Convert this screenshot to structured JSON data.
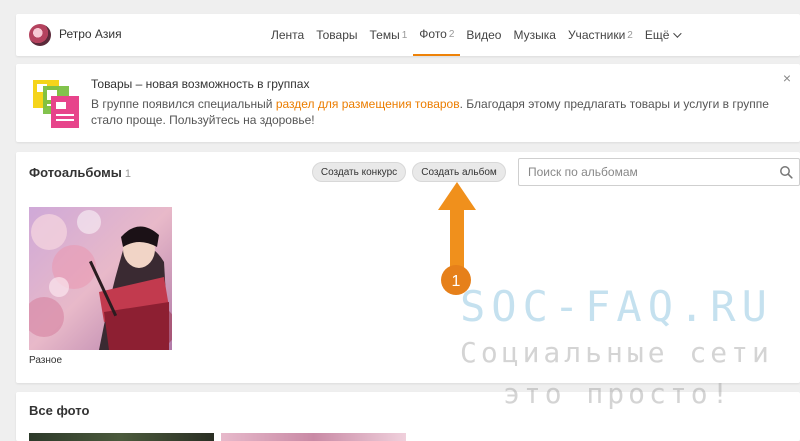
{
  "group": {
    "name": "Ретро Азия"
  },
  "nav": [
    {
      "label": "Лента",
      "count": ""
    },
    {
      "label": "Товары",
      "count": ""
    },
    {
      "label": "Темы",
      "count": "1"
    },
    {
      "label": "Фото",
      "count": "2"
    },
    {
      "label": "Видео",
      "count": ""
    },
    {
      "label": "Музыка",
      "count": ""
    },
    {
      "label": "Участники",
      "count": "2"
    },
    {
      "label": "Ещё",
      "count": ""
    }
  ],
  "active_nav": "Фото",
  "promo": {
    "title": "Товары – новая возможность в группах",
    "text_before": "В группе появился специальный ",
    "link": "раздел для размещения товаров",
    "text_after": ". Благодаря этому предлагать товары и услуги в группе стало проще. Пользуйтесь на здоровье!",
    "close": "×"
  },
  "albums": {
    "title": "Фотоальбомы",
    "count": "1",
    "btn_contest": "Создать конкурс",
    "btn_album": "Создать альбом",
    "search_placeholder": "Поиск по альбомам",
    "items": [
      {
        "label": "Разное"
      }
    ]
  },
  "all_photos": {
    "title": "Все фото"
  },
  "annotation": {
    "step": "1"
  },
  "watermark": {
    "line1": "SOC-FAQ.RU",
    "line2": "Социальные сети",
    "line3": "это просто!"
  },
  "colors": {
    "accent": "#ee8208",
    "link": "#eb7d00",
    "arrow": "#f0901c"
  }
}
